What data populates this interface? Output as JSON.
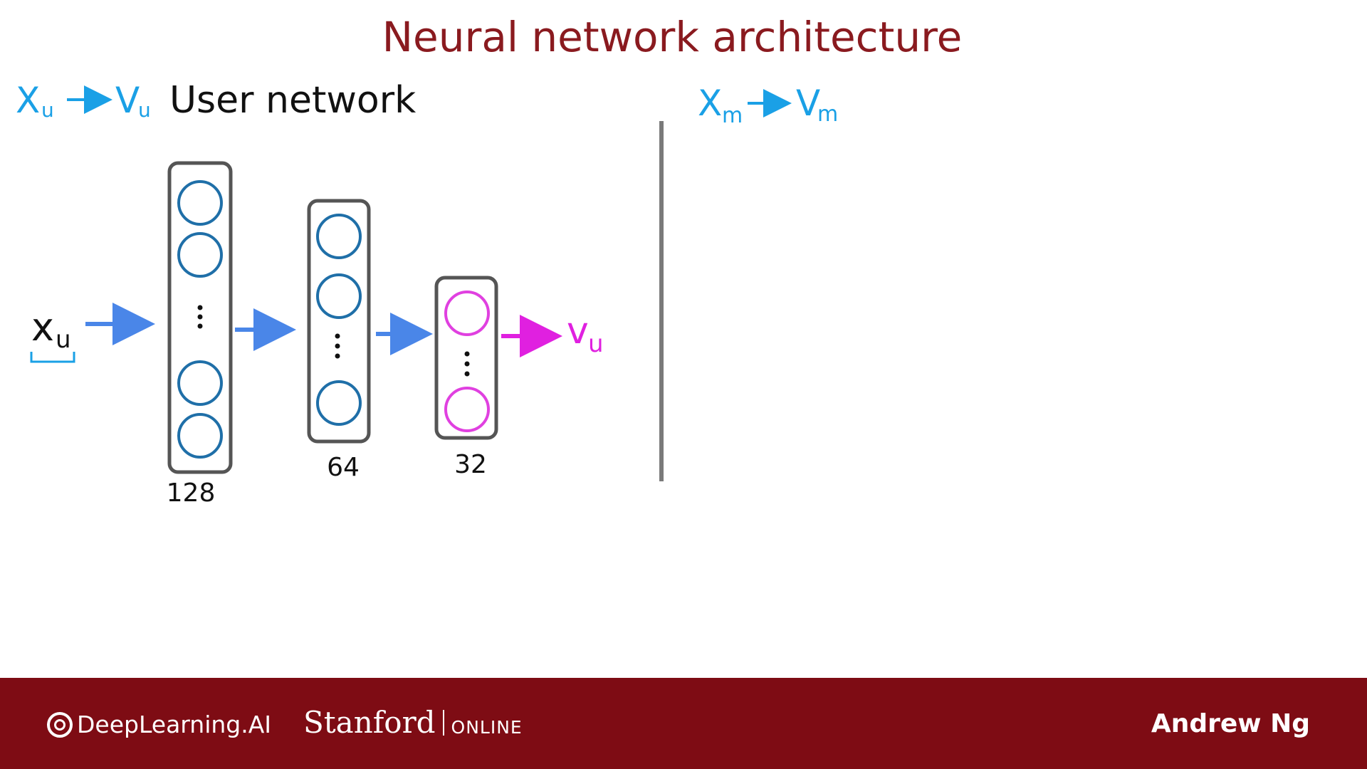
{
  "slide": {
    "title": "Neural network architecture"
  },
  "user_side": {
    "mapping_from": "X",
    "mapping_from_sub": "u",
    "mapping_to": "V",
    "mapping_to_sub": "u",
    "heading": "User network",
    "input_label": "x",
    "input_sub": "u",
    "output_label": "v",
    "output_sub": "u",
    "layers": [
      {
        "size_label": "128"
      },
      {
        "size_label": "64"
      },
      {
        "size_label": "32"
      }
    ]
  },
  "movie_side": {
    "mapping_from": "X",
    "mapping_from_sub": "m",
    "mapping_to": "V",
    "mapping_to_sub": "m"
  },
  "colors": {
    "title": "#8a1a1f",
    "handwriting": "#1aa0e6",
    "neuron": "#1f6fa8",
    "output_neuron": "#e040e0",
    "arrow": "#4a86e8",
    "footer": "#7e0c14"
  },
  "footer": {
    "brand1": "DeepLearning.AI",
    "brand2": "Stanford",
    "brand2_suffix": "ONLINE",
    "author": "Andrew Ng"
  }
}
